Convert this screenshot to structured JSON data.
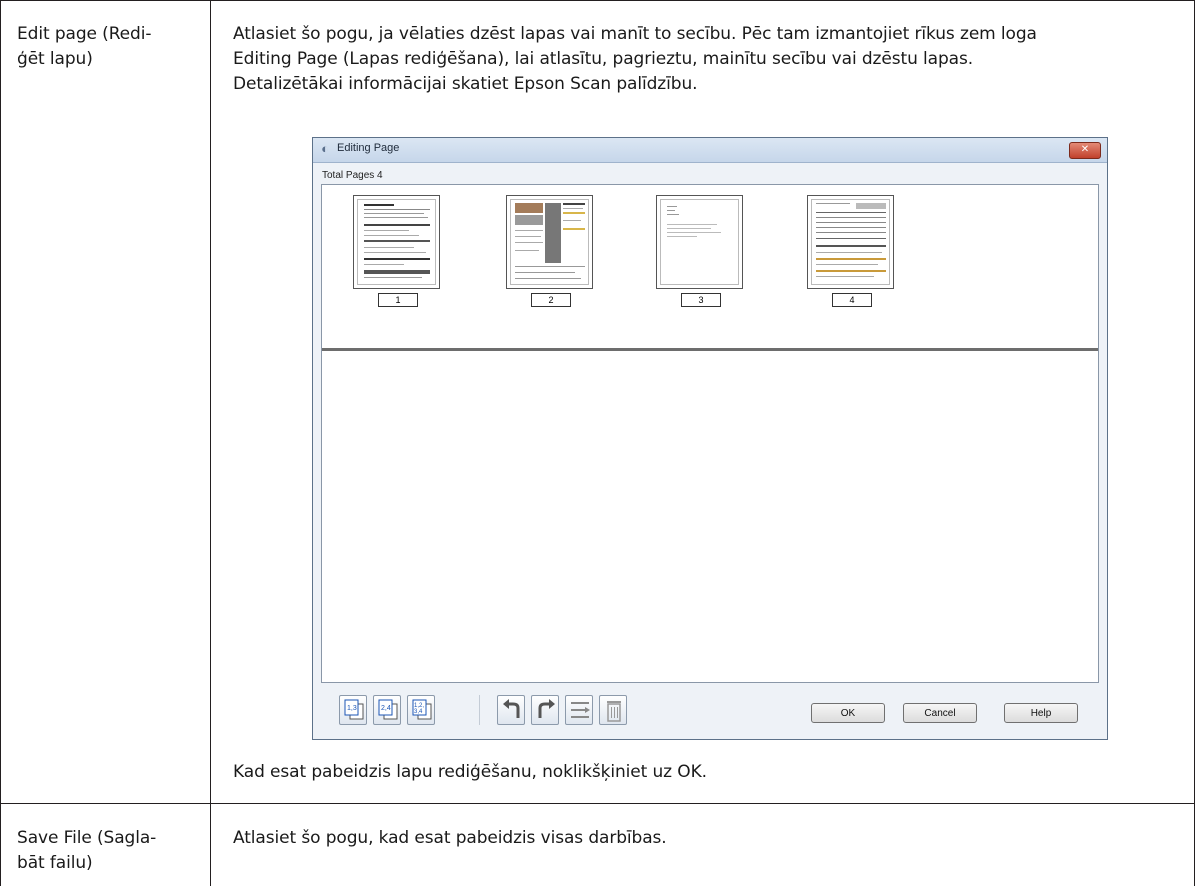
{
  "rows": [
    {
      "label_lines": [
        "Edit page (Redi-",
        "ģēt lapu)"
      ],
      "description_lines": [
        "Atlasiet šo pogu, ja vēlaties dzēst lapas vai manīt to secību. Pēc tam izmantojiet rīkus zem loga",
        "Editing Page (Lapas rediģēšana), lai atlasītu, pagrieztu, mainītu secību vai dzēstu lapas.",
        "Detalizētākai informācijai skatiet Epson Scan palīdzību."
      ],
      "footer_text": "Kad esat pabeidzis lapu rediģēšanu, noklikšķiniet uz OK."
    },
    {
      "label_lines": [
        "Save File (Sagla-",
        "bāt failu)"
      ],
      "description_lines": [
        "Atlasiet šo pogu, kad esat pabeidzis visas darbības."
      ]
    }
  ],
  "dialog": {
    "title": "Editing Page",
    "total_pages_label": "Total Pages 4",
    "close_glyph": "✕",
    "pages": [
      "1",
      "2",
      "3",
      "4"
    ],
    "buttons": {
      "ok": "OK",
      "cancel": "Cancel",
      "help": "Help"
    },
    "tool_icons": [
      "select-odd-pages-icon",
      "select-even-pages-icon",
      "select-all-pages-icon",
      "rotate-left-icon",
      "rotate-right-icon",
      "reorder-icon",
      "delete-icon"
    ]
  }
}
